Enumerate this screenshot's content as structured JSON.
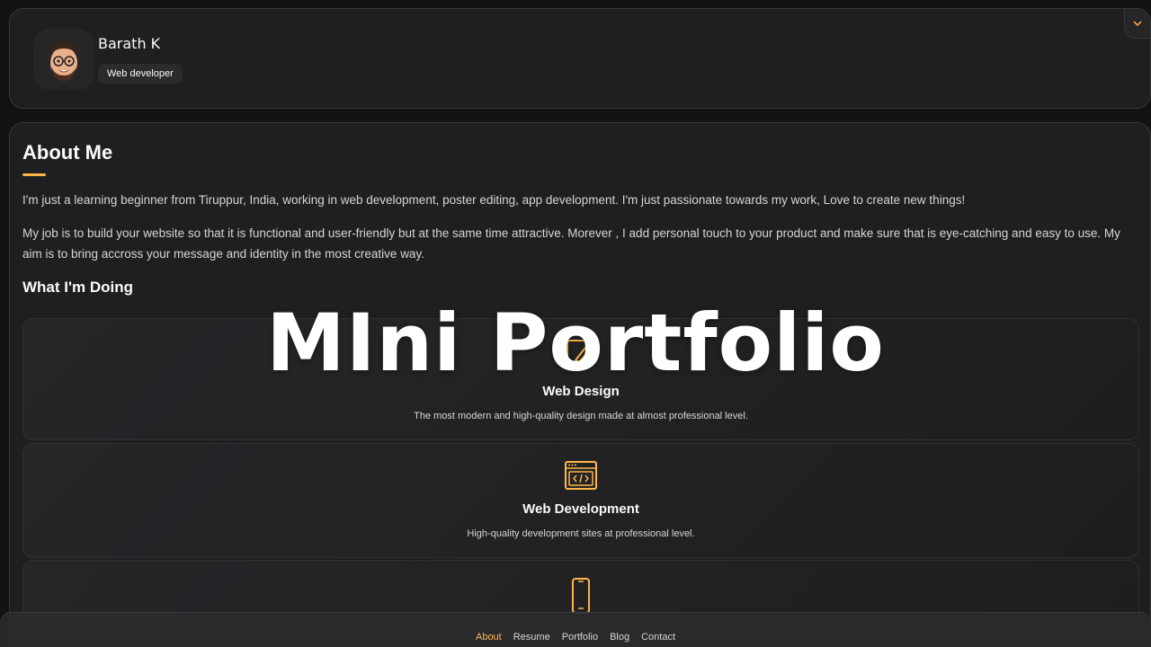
{
  "profile": {
    "name": "Barath K",
    "role": "Web developer"
  },
  "about": {
    "title": "About Me",
    "paragraphs": [
      "I'm just a learning beginner from Tiruppur, India, working in web development, poster editing, app development. I'm just passionate towards my work, Love to create new things!",
      "My job is to build your website so that it is functional and user-friendly but at the same time attractive. Morever , I add personal touch to your product and make sure that is eye-catching and easy to use. My aim is to bring accross your message and identity in the most creative way."
    ],
    "doing_title": "What I'm Doing",
    "services": [
      {
        "title": "Web Design",
        "text": "The most modern and high-quality design made at almost professional level.",
        "icon": "design-icon"
      },
      {
        "title": "Web Development",
        "text": "High-quality development sites at professional level.",
        "icon": "code-icon"
      },
      {
        "title": "",
        "text": "",
        "icon": "mobile-app-icon"
      }
    ]
  },
  "overlay_title": "MIni Portfolio",
  "nav": {
    "items": [
      "About",
      "Resume",
      "Portfolio",
      "Blog",
      "Contact"
    ],
    "active": "About"
  },
  "colors": {
    "accent": "#ffb547",
    "background": "#121212",
    "card": "#1f1f21"
  }
}
